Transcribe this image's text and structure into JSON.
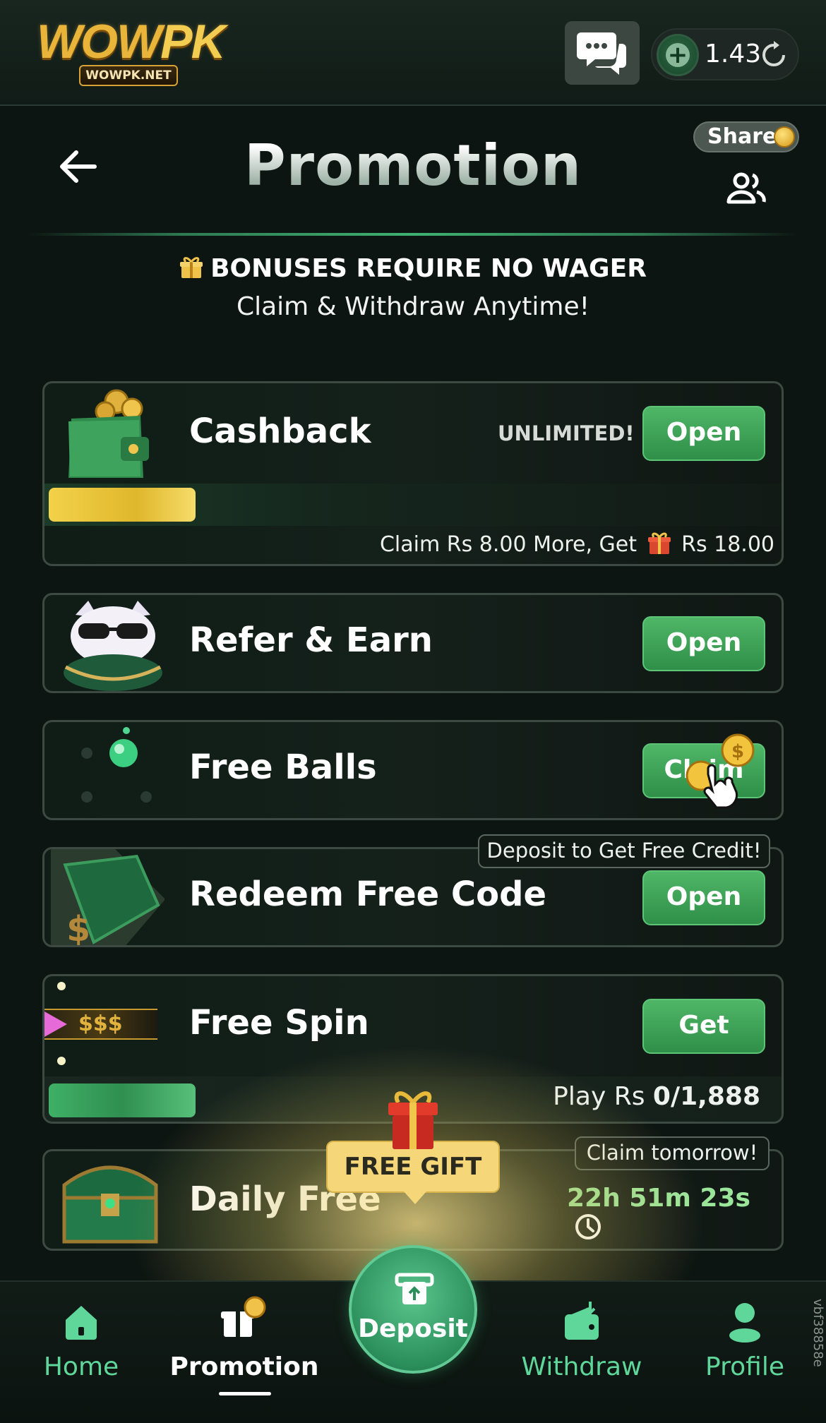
{
  "app": {
    "logo_text_main": "WOW",
    "logo_text_accent": "PK",
    "logo_sub": "WOWPK.NET",
    "balance": "1.43"
  },
  "header": {
    "title": "Promotion",
    "share_label": "Share"
  },
  "banner": {
    "title": "BONUSES REQUIRE NO WAGER",
    "subtitle": "Claim & Withdraw Anytime!"
  },
  "cards": {
    "cashback": {
      "title": "Cashback",
      "badge": "UNLIMITED!",
      "button": "Open",
      "claim_prefix": "Claim Rs 8.00 More, Get",
      "claim_amount": "Rs 18.00",
      "progress": 0.2
    },
    "refer": {
      "title": "Refer & Earn",
      "button": "Open"
    },
    "free_balls": {
      "title": "Free Balls",
      "button": "Claim"
    },
    "redeem": {
      "title": "Redeem Free Code",
      "button": "Open",
      "tag": "Deposit to Get Free Credit!"
    },
    "free_spin": {
      "title": "Free Spin",
      "button": "Get",
      "reel_text": "$$$",
      "play_prefix": "Play Rs",
      "play_value": "0/1,888",
      "progress": 0.2
    },
    "daily_free": {
      "title": "Daily Free",
      "tag": "Claim tomorrow!",
      "timer": "22h 51m 23s"
    }
  },
  "popup": {
    "free_gift": "FREE GIFT"
  },
  "nav": {
    "home": "Home",
    "promotion": "Promotion",
    "deposit": "Deposit",
    "withdraw": "Withdraw",
    "profile": "Profile"
  },
  "side_code": "vbf38858e",
  "colors": {
    "accent_green": "#3fa85a",
    "gold": "#e8b53a",
    "background": "#0d1512"
  }
}
